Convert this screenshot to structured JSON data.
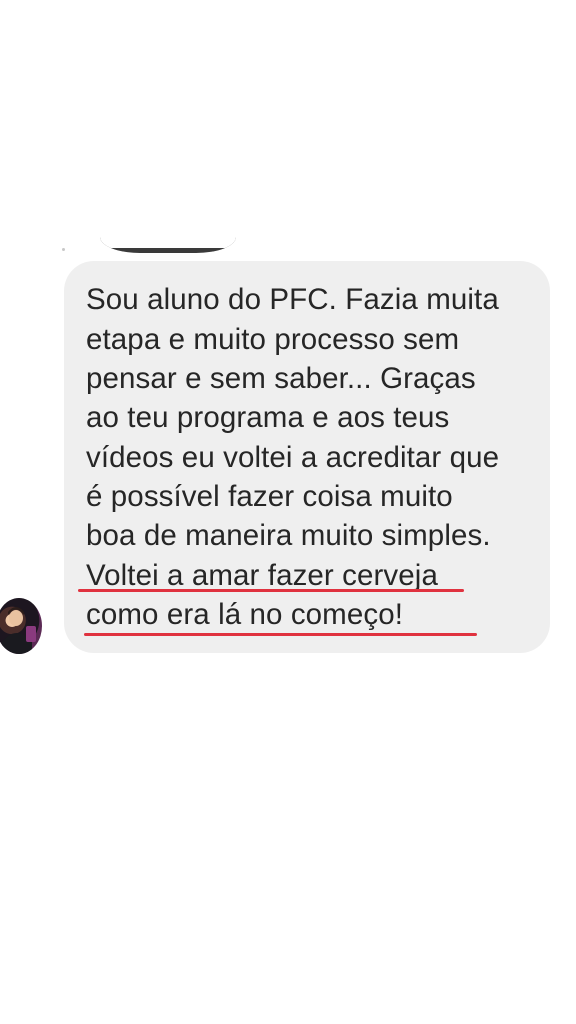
{
  "conversation": {
    "message": {
      "lines": [
        "Sou aluno do PFC. Fazia muita",
        "etapa e muito processo sem",
        "pensar e sem saber... Graças",
        "ao teu programa e aos teus",
        "vídeos eu voltei a acreditar que",
        "é possível fazer coisa muito",
        "boa de maneira muito simples.",
        "Voltei a amar fazer cerveja",
        "como era lá no começo!"
      ]
    },
    "highlight_color": "#e0323f",
    "bubble_color": "#efefef"
  }
}
